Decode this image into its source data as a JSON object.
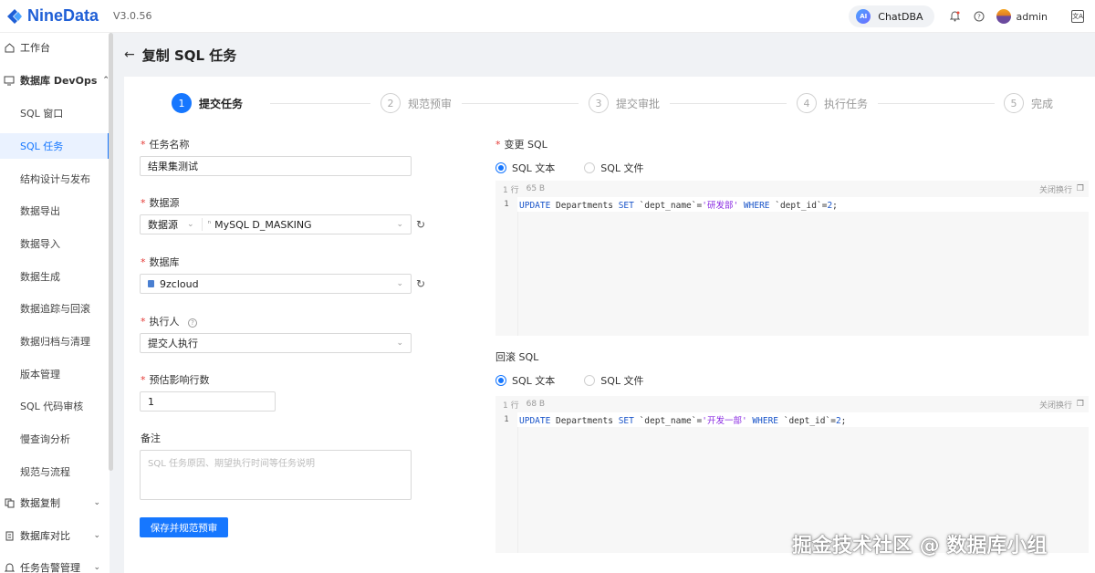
{
  "app": {
    "name": "NineData",
    "version": "V3.0.56"
  },
  "topbar": {
    "chatdba_badge": "AI",
    "chatdba_label": "ChatDBA",
    "user_name": "admin",
    "lang_label": "文A"
  },
  "sidebar": {
    "workbench": "工作台",
    "devops_group": "数据库 DevOps",
    "items": [
      "SQL 窗口",
      "SQL 任务",
      "结构设计与发布",
      "数据导出",
      "数据导入",
      "数据生成",
      "数据追踪与回滚",
      "数据归档与清理",
      "版本管理",
      "SQL 代码审核",
      "慢查询分析",
      "规范与流程"
    ],
    "replication": "数据复制",
    "compare": "数据库对比",
    "alarm": "任务告警管理"
  },
  "page": {
    "title": "复制 SQL 任务"
  },
  "steps": [
    {
      "num": "1",
      "label": "提交任务"
    },
    {
      "num": "2",
      "label": "规范预审"
    },
    {
      "num": "3",
      "label": "提交审批"
    },
    {
      "num": "4",
      "label": "执行任务"
    },
    {
      "num": "5",
      "label": "完成"
    }
  ],
  "form": {
    "task_name_label": "任务名称",
    "task_name_value": "结果集测试",
    "datasource_label": "数据源",
    "datasource_type": "数据源",
    "datasource_value": "MySQL D_MASKING",
    "database_label": "数据库",
    "database_value": "9zcloud",
    "executor_label": "执行人",
    "executor_value": "提交人执行",
    "rows_label": "预估影响行数",
    "rows_value": "1",
    "remark_label": "备注",
    "remark_placeholder": "SQL 任务原因、期望执行时间等任务说明",
    "submit_button": "保存并规范预审"
  },
  "change_sql": {
    "label": "变更 SQL",
    "radio_text": "SQL 文本",
    "radio_file": "SQL 文件",
    "lines": "1 行",
    "size": "65 B",
    "wrap": "关闭换行",
    "line_no": "1",
    "code": {
      "kw1": "UPDATE",
      "t1": " Departments ",
      "kw2": "SET",
      "t2": " `dept_name`=",
      "val": "'研发部'",
      "t3": " ",
      "kw3": "WHERE",
      "t4": " `dept_id`=",
      "num": "2",
      "t5": ";"
    }
  },
  "rollback_sql": {
    "label": "回滚 SQL",
    "radio_text": "SQL 文本",
    "radio_file": "SQL 文件",
    "lines": "1 行",
    "size": "68 B",
    "wrap": "关闭换行",
    "line_no": "1",
    "code": {
      "kw1": "UPDATE",
      "t1": " Departments ",
      "kw2": "SET",
      "t2": " `dept_name`=",
      "val": "'开发一部'",
      "t3": " ",
      "kw3": "WHERE",
      "t4": " `dept_id`=",
      "num": "2",
      "t5": ";"
    }
  },
  "watermark": "掘金技术社区 @ 数据库小组"
}
